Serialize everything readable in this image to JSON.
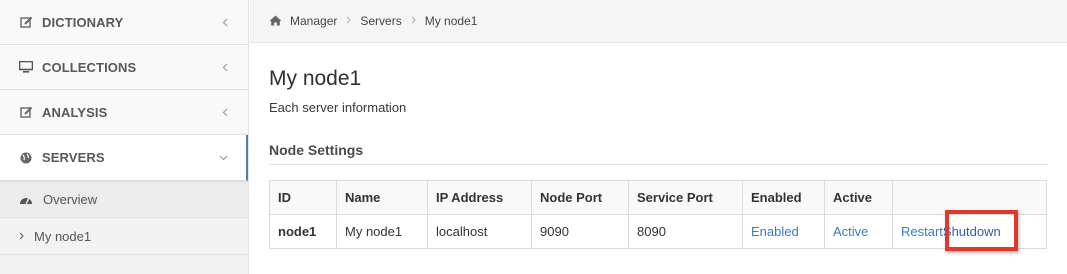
{
  "sidebar": {
    "items": [
      {
        "name": "dictionary",
        "label": "DICTIONARY",
        "icon": "edit-icon"
      },
      {
        "name": "collections",
        "label": "COLLECTIONS",
        "icon": "monitor-icon"
      },
      {
        "name": "analysis",
        "label": "ANALYSIS",
        "icon": "edit-icon"
      },
      {
        "name": "servers",
        "label": "SERVERS",
        "icon": "globe-icon"
      }
    ],
    "sub_items": [
      {
        "label": "Overview",
        "icon": "dashboard-icon"
      },
      {
        "label": "My node1",
        "icon": "caret-right-icon"
      }
    ]
  },
  "breadcrumb": {
    "home": "Manager",
    "level2": "Servers",
    "current": "My node1"
  },
  "main": {
    "title": "My node1",
    "description": "Each server information",
    "section_title": "Node Settings"
  },
  "table": {
    "headers": [
      "ID",
      "Name",
      "IP Address",
      "Node Port",
      "Service Port",
      "Enabled",
      "Active",
      ""
    ],
    "row": {
      "id": "node1",
      "name": "My node1",
      "ip": "localhost",
      "node_port": "9090",
      "service_port": "8090",
      "enabled": "Enabled",
      "active": "Active",
      "restart": "Restart",
      "shutdown": "Shutdown"
    }
  },
  "colors": {
    "link": "#3a7bbf",
    "highlight": "#e0392b",
    "active_border": "#4f7fa8"
  }
}
